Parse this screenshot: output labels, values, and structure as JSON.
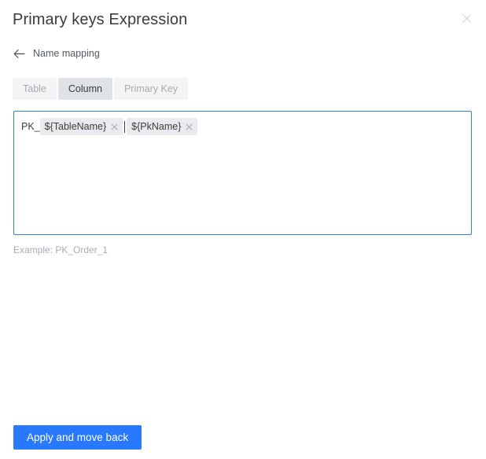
{
  "dialog": {
    "title": "Primary keys Expression",
    "close_icon": "close-icon"
  },
  "back_link": {
    "icon": "arrow-left-icon",
    "label": "Name mapping"
  },
  "tabs": [
    {
      "label": "Table",
      "active": false
    },
    {
      "label": "Column",
      "active": true
    },
    {
      "label": "Primary Key",
      "active": false
    }
  ],
  "expression": {
    "prefix_text": "PK_",
    "tokens": [
      {
        "label": "${TableName}",
        "remove_icon": "close-icon"
      },
      {
        "label": "${PkName}",
        "remove_icon": "close-icon"
      }
    ],
    "caret_visible": true
  },
  "helper": {
    "text": "Example: PK_Order_1"
  },
  "actions": {
    "apply_label": "Apply and move back"
  },
  "colors": {
    "accent_blue": "#2979ff",
    "focus_border": "#3b82d6",
    "tab_active_bg": "#dfe3e8",
    "tab_inactive_bg": "#f3f4f6",
    "chip_bg": "#e9ebee",
    "title_text": "#3b3b3b",
    "muted_text": "#a8acb2"
  }
}
